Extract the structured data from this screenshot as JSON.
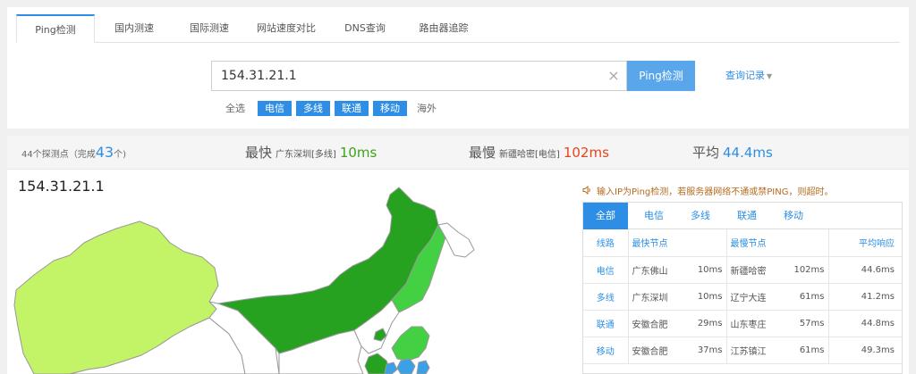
{
  "tabs": [
    {
      "label": "Ping检测",
      "active": true
    },
    {
      "label": "国内测速"
    },
    {
      "label": "国际测速"
    },
    {
      "label": "网站速度对比"
    },
    {
      "label": "DNS查询"
    },
    {
      "label": "路由器追踪"
    }
  ],
  "search": {
    "value": "154.31.21.1",
    "clear_icon": "×",
    "button": "Ping检测",
    "history": "查询记录"
  },
  "filters": [
    {
      "label": "全选",
      "on": false
    },
    {
      "label": "电信",
      "on": true
    },
    {
      "label": "多线",
      "on": true
    },
    {
      "label": "联通",
      "on": true
    },
    {
      "label": "移动",
      "on": true
    },
    {
      "label": "海外",
      "on": false
    }
  ],
  "stats": {
    "probe_prefix": "44个探测点（完成",
    "probe_done": "43",
    "probe_suffix": "个)",
    "fastest_label": "最快",
    "fastest_loc": "广东深圳[多线]",
    "fastest_val": "10ms",
    "slowest_label": "最慢",
    "slowest_loc": "新疆哈密[电信]",
    "slowest_val": "102ms",
    "avg_label": "平均",
    "avg_val": "44.4ms"
  },
  "map": {
    "title": "154.31.21.1",
    "colors": {
      "xinjiang": "#c3f468",
      "dark": "#26a220",
      "mid": "#43d043",
      "blue": "#3aa0e8",
      "empty": "#ffffff",
      "border": "#999999"
    }
  },
  "notice": {
    "icon": "speaker-icon",
    "text": "输入IP为Ping检测，若服务器网络不通或禁PING，则超时。"
  },
  "isp_tabs": [
    {
      "label": "全部",
      "active": true
    },
    {
      "label": "电信"
    },
    {
      "label": "多线"
    },
    {
      "label": "联通"
    },
    {
      "label": "移动"
    }
  ],
  "table": {
    "headers": {
      "line": "线路",
      "fastest": "最快节点",
      "slowest": "最慢节点",
      "avg": "平均响应"
    },
    "rows": [
      {
        "line": "电信",
        "fast_node": "广东佛山",
        "fast_val": "10ms",
        "slow_node": "新疆哈密",
        "slow_val": "102ms",
        "avg": "44.6ms"
      },
      {
        "line": "多线",
        "fast_node": "广东深圳",
        "fast_val": "10ms",
        "slow_node": "辽宁大连",
        "slow_val": "61ms",
        "avg": "41.2ms"
      },
      {
        "line": "联通",
        "fast_node": "安徽合肥",
        "fast_val": "29ms",
        "slow_node": "山东枣庄",
        "slow_val": "57ms",
        "avg": "44.8ms"
      },
      {
        "line": "移动",
        "fast_node": "安徽合肥",
        "fast_val": "37ms",
        "slow_node": "江苏镇江",
        "slow_val": "61ms",
        "avg": "49.3ms"
      }
    ]
  }
}
